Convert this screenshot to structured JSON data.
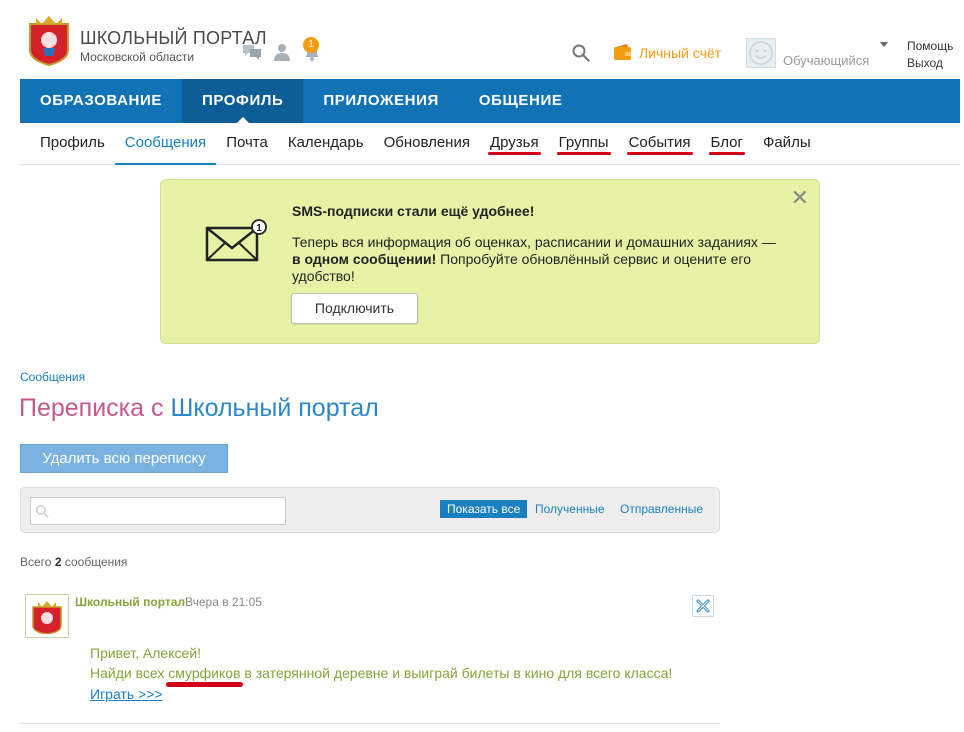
{
  "header": {
    "brand_title": "ШКОЛЬНЫЙ ПОРТАЛ",
    "brand_subtitle": "Московской области",
    "notification_count": "1",
    "wallet_label": "Личный счёт",
    "user_role": "Обучающийся",
    "help_label": "Помощь",
    "logout_label": "Выход",
    "accent_color": "#f39c12"
  },
  "main_nav": {
    "items": [
      {
        "label": "ОБРАЗОВАНИЕ"
      },
      {
        "label": "ПРОФИЛЬ",
        "active": true
      },
      {
        "label": "ПРИЛОЖЕНИЯ"
      },
      {
        "label": "ОБЩЕНИЕ"
      }
    ],
    "color": "#1173b6"
  },
  "sub_nav": {
    "items": [
      {
        "label": "Профиль"
      },
      {
        "label": "Сообщения",
        "active": true
      },
      {
        "label": "Почта"
      },
      {
        "label": "Календарь"
      },
      {
        "label": "Обновления"
      },
      {
        "label": "Друзья",
        "underlined_red": true
      },
      {
        "label": "Группы",
        "underlined_red": true
      },
      {
        "label": "События",
        "underlined_red": true
      },
      {
        "label": "Блог",
        "underlined_red": true
      },
      {
        "label": "Файлы"
      }
    ]
  },
  "banner": {
    "title": "SMS-подписки стали ещё удобнее!",
    "text_before": "Теперь вся информация об оценках, расписании и домашних заданиях — ",
    "text_bold": "в одном сообщении!",
    "text_after": " Попробуйте обновлённый сервис и оцените его удобство!",
    "button_label": "Подключить",
    "envelope_badge": "1",
    "background": "#e8f2a6"
  },
  "messages": {
    "breadcrumb": "Сообщения",
    "title_prefix": "Переписка с ",
    "title_accent": "Школьный портал",
    "delete_all_label": "Удалить всю переписку",
    "search_placeholder": "",
    "filters": {
      "all": "Показать все",
      "received": "Полученные",
      "sent": "Отправленные"
    },
    "count_prefix": "Всего ",
    "count_value": "2",
    "count_suffix": " сообщения",
    "items": [
      {
        "sender": "Школьный портал",
        "time": "Вчера в 21:05",
        "line1": "Привет, Алексей!",
        "line2_before": "Найди всех ",
        "line2_highlight": "смурфиков",
        "line2_after": " в затерянной деревне и выиграй билеты в кино для всего класса!",
        "link": "Играть >>>"
      }
    ]
  }
}
